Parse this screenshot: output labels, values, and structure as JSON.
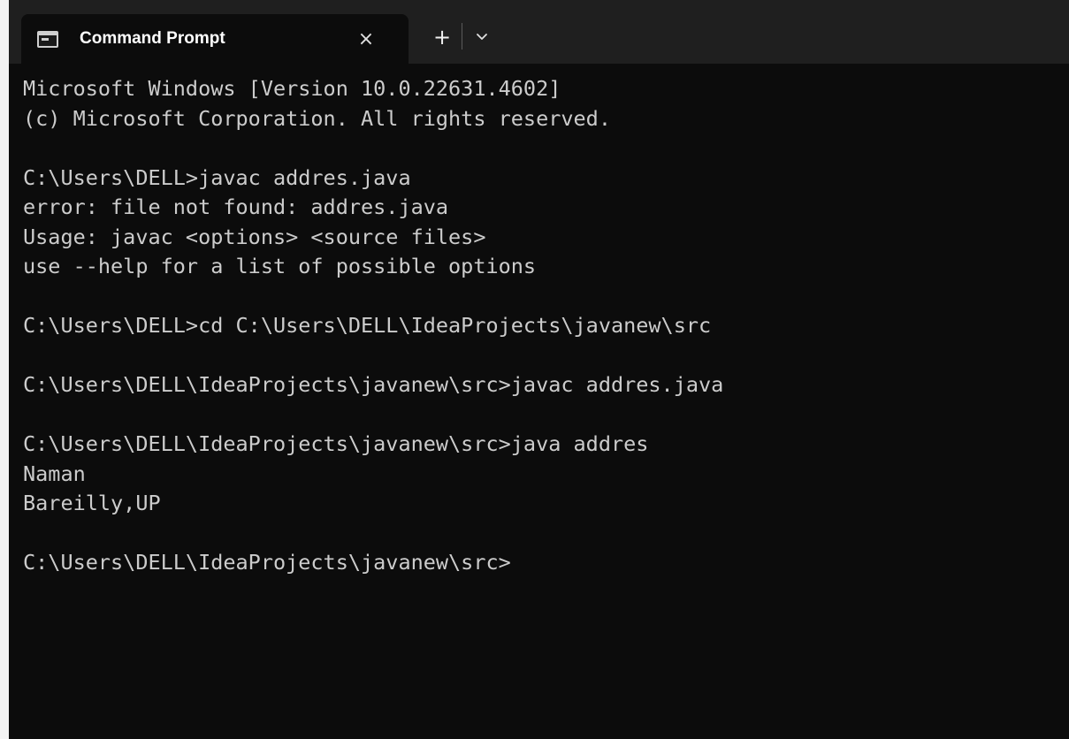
{
  "tab": {
    "title": "Command Prompt",
    "close_label": "×"
  },
  "titlebar": {
    "new_tab_label": "+"
  },
  "terminal": {
    "lines": [
      "Microsoft Windows [Version 10.0.22631.4602]",
      "(c) Microsoft Corporation. All rights reserved.",
      "",
      "C:\\Users\\DELL>javac addres.java",
      "error: file not found: addres.java",
      "Usage: javac <options> <source files>",
      "use --help for a list of possible options",
      "",
      "C:\\Users\\DELL>cd C:\\Users\\DELL\\IdeaProjects\\javanew\\src",
      "",
      "C:\\Users\\DELL\\IdeaProjects\\javanew\\src>javac addres.java",
      "",
      "C:\\Users\\DELL\\IdeaProjects\\javanew\\src>java addres",
      "Naman",
      "Bareilly,UP",
      "",
      "C:\\Users\\DELL\\IdeaProjects\\javanew\\src>"
    ]
  },
  "colors": {
    "background": "#0c0c0c",
    "titlebar": "#1f1f1f",
    "text": "#cccccc"
  },
  "icons": {
    "tab_icon": "command-prompt-icon",
    "dropdown_icon": "chevron-down-icon"
  }
}
